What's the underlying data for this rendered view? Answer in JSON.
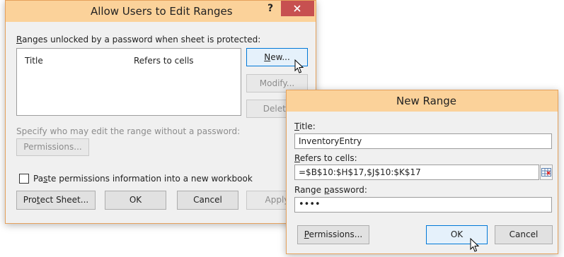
{
  "allow_dialog": {
    "title": "Allow Users to Edit Ranges",
    "help_glyph": "?",
    "ranges_label_u": "R",
    "ranges_label_rest": "anges unlocked by a password when sheet is protected:",
    "columns": [
      "Title",
      "Refers to cells"
    ],
    "rows": [],
    "new_button_u": "N",
    "new_button_rest": "ew...",
    "modify_button": "Modify...",
    "delete_button": "Delete",
    "specify_label": "Specify who may edit the range without a password:",
    "permissions_button": "Permissions...",
    "paste_label_pre": "Pa",
    "paste_label_u": "s",
    "paste_label_rest": "te permissions information into a new workbook",
    "paste_checked": false,
    "protect_button_pre": "Pro",
    "protect_button_u": "t",
    "protect_button_rest": "ect Sheet...",
    "ok_button": "OK",
    "cancel_button": "Cancel",
    "apply_button": "Apply"
  },
  "new_range_dialog": {
    "title": "New Range",
    "title_label_u": "T",
    "title_label_rest": "itle:",
    "title_value": "InventoryEntry",
    "refers_label_u": "R",
    "refers_label_rest": "efers to cells:",
    "refers_value": "=$B$10:$H$17,$J$10:$K$17",
    "password_label_pre": "Range ",
    "password_label_u": "p",
    "password_label_rest": "assword:",
    "password_value": "••••",
    "permissions_button_u": "P",
    "permissions_button_rest": "ermissions...",
    "ok_button": "OK",
    "cancel_button": "Cancel"
  },
  "icons": [
    "close-icon",
    "range-picker-icon",
    "mouse-pointer-icon"
  ],
  "colors": {
    "titlebar": "#fbd29a",
    "border": "#e5a15c",
    "close": "#c75050",
    "focus": "#0078d7"
  }
}
